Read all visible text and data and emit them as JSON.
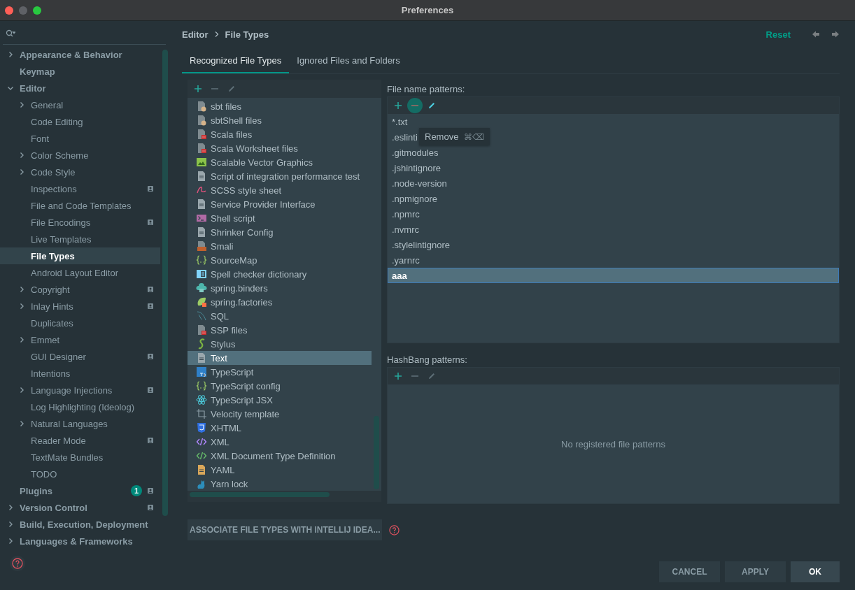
{
  "window": {
    "title": "Preferences"
  },
  "sidebar": {
    "items": [
      {
        "label": "Appearance & Behavior",
        "selected": false,
        "expanded": false
      },
      {
        "label": "Keymap",
        "selected": false
      },
      {
        "label": "Editor",
        "selected": false,
        "expanded": true,
        "children": [
          {
            "label": "General",
            "selected": false,
            "expanded": false
          },
          {
            "label": "Code Editing",
            "selected": false
          },
          {
            "label": "Font",
            "selected": false
          },
          {
            "label": "Color Scheme",
            "selected": false,
            "expanded": false
          },
          {
            "label": "Code Style",
            "selected": false,
            "expanded": false
          },
          {
            "label": "Inspections",
            "selected": false,
            "project_level": true
          },
          {
            "label": "File and Code Templates",
            "selected": false
          },
          {
            "label": "File Encodings",
            "selected": false,
            "project_level": true
          },
          {
            "label": "Live Templates",
            "selected": false
          },
          {
            "label": "File Types",
            "selected": true
          },
          {
            "label": "Android Layout Editor",
            "selected": false
          },
          {
            "label": "Copyright",
            "selected": false,
            "expanded": false,
            "project_level": true
          },
          {
            "label": "Inlay Hints",
            "selected": false,
            "expanded": false,
            "project_level": true
          },
          {
            "label": "Duplicates",
            "selected": false
          },
          {
            "label": "Emmet",
            "selected": false,
            "expanded": false
          },
          {
            "label": "GUI Designer",
            "selected": false,
            "project_level": true
          },
          {
            "label": "Intentions",
            "selected": false
          },
          {
            "label": "Language Injections",
            "selected": false,
            "expanded": false,
            "project_level": true
          },
          {
            "label": "Log Highlighting (Ideolog)",
            "selected": false
          },
          {
            "label": "Natural Languages",
            "selected": false,
            "expanded": false
          },
          {
            "label": "Reader Mode",
            "selected": false,
            "project_level": true
          },
          {
            "label": "TextMate Bundles",
            "selected": false
          },
          {
            "label": "TODO",
            "selected": false
          }
        ]
      },
      {
        "label": "Plugins",
        "selected": false,
        "count": "1",
        "project_level": true
      },
      {
        "label": "Version Control",
        "selected": false,
        "expanded": false,
        "project_level": true
      },
      {
        "label": "Build, Execution, Deployment",
        "selected": false,
        "expanded": false
      },
      {
        "label": "Languages & Frameworks",
        "selected": false,
        "expanded": false
      }
    ]
  },
  "breadcrumb": [
    "Editor",
    "File Types"
  ],
  "reset": "Reset",
  "tabs": [
    {
      "label": "Recognized File Types",
      "selected": true
    },
    {
      "label": "Ignored Files and Folders",
      "selected": false
    }
  ],
  "file_types": {
    "toolbar": [
      {
        "kind": "add",
        "disabled": false
      },
      {
        "kind": "remove",
        "disabled": true
      },
      {
        "kind": "edit",
        "disabled": true
      }
    ],
    "items": [
      {
        "label": "sbt files",
        "kind": "doc-dot",
        "selected": false
      },
      {
        "label": "sbtShell files",
        "kind": "doc-dot",
        "selected": false
      },
      {
        "label": "Scala files",
        "kind": "doc-red",
        "selected": false
      },
      {
        "label": "Scala Worksheet files",
        "kind": "doc-red",
        "selected": false
      },
      {
        "label": "Scalable Vector Graphics",
        "kind": "image",
        "selected": false
      },
      {
        "label": "Script of integration performance test",
        "kind": "doc",
        "selected": false
      },
      {
        "label": "SCSS style sheet",
        "kind": "script",
        "selected": false
      },
      {
        "label": "Service Provider Interface",
        "kind": "doc",
        "selected": false
      },
      {
        "label": "Shell script",
        "kind": "terminal",
        "selected": false
      },
      {
        "label": "Shrinker Config",
        "kind": "doc",
        "selected": false
      },
      {
        "label": "Smali",
        "kind": "doc-orange",
        "selected": false
      },
      {
        "label": "SourceMap",
        "kind": "braces",
        "selected": false
      },
      {
        "label": "Spell checker dictionary",
        "kind": "book",
        "selected": false
      },
      {
        "label": "spring.binders",
        "kind": "cloud",
        "selected": false
      },
      {
        "label": "spring.factories",
        "kind": "leaf",
        "selected": false
      },
      {
        "label": "SQL",
        "kind": "squiggle",
        "selected": false
      },
      {
        "label": "SSP files",
        "kind": "doc-red",
        "selected": false
      },
      {
        "label": "Stylus",
        "kind": "s-curve",
        "selected": false
      },
      {
        "label": "Text",
        "kind": "doc",
        "selected": true
      },
      {
        "label": "TypeScript",
        "kind": "square",
        "selected": false
      },
      {
        "label": "TypeScript config",
        "kind": "braces",
        "selected": false
      },
      {
        "label": "TypeScript JSX",
        "kind": "atom",
        "selected": false
      },
      {
        "label": "Velocity template",
        "kind": "crop",
        "selected": false
      },
      {
        "label": "XHTML",
        "kind": "shield",
        "selected": false
      },
      {
        "label": "XML",
        "kind": "code-purple",
        "selected": false
      },
      {
        "label": "XML Document Type Definition",
        "kind": "code-green",
        "selected": false
      },
      {
        "label": "YAML",
        "kind": "doc-yellow",
        "selected": false
      },
      {
        "label": "Yarn lock",
        "kind": "cat",
        "selected": false
      }
    ]
  },
  "file_name_patterns": {
    "label": "File name patterns:",
    "toolbar": [
      {
        "kind": "add",
        "disabled": false,
        "hovered": false
      },
      {
        "kind": "remove",
        "disabled": false,
        "hovered": true
      },
      {
        "kind": "edit",
        "disabled": false,
        "hovered": false
      }
    ],
    "items": [
      {
        "text": "*.txt",
        "selected": false
      },
      {
        "text": ".eslinti",
        "selected": false
      },
      {
        "text": ".gitmodules",
        "selected": false
      },
      {
        "text": ".jshintignore",
        "selected": false
      },
      {
        "text": ".node-version",
        "selected": false
      },
      {
        "text": ".npmignore",
        "selected": false
      },
      {
        "text": ".npmrc",
        "selected": false
      },
      {
        "text": ".nvmrc",
        "selected": false
      },
      {
        "text": ".stylelintignore",
        "selected": false
      },
      {
        "text": ".yarnrc",
        "selected": false
      },
      {
        "text": "aaa",
        "selected": true
      }
    ],
    "tooltip": {
      "text": "Remove",
      "shortcut": "⌘⌫"
    }
  },
  "hashbang_patterns": {
    "label": "HashBang patterns:",
    "toolbar": [
      {
        "kind": "add",
        "disabled": false,
        "hovered": false
      },
      {
        "kind": "remove",
        "disabled": true,
        "hovered": false
      },
      {
        "kind": "edit",
        "disabled": true,
        "hovered": false
      }
    ],
    "empty_text": "No registered file patterns"
  },
  "associate_button": "ASSOCIATE FILE TYPES WITH INTELLIJ IDEA...",
  "buttons": [
    {
      "label": "CANCEL",
      "default": false
    },
    {
      "label": "APPLY",
      "default": false
    },
    {
      "label": "OK",
      "default": true
    }
  ]
}
